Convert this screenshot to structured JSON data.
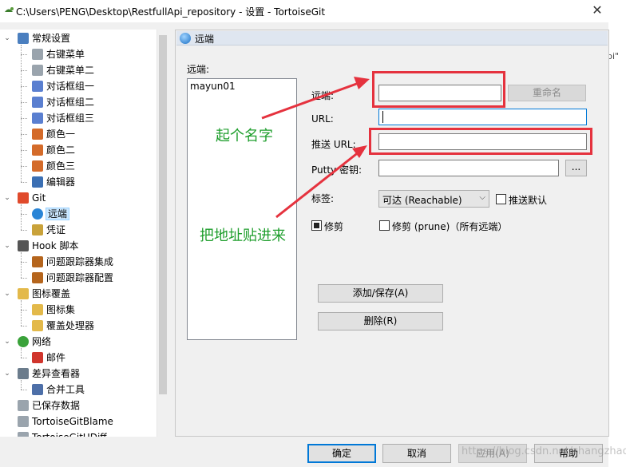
{
  "window": {
    "title": "C:\\Users\\PENG\\Desktop\\RestfullApi_repository - 设置 - TortoiseGit",
    "close_glyph": "✕",
    "background_text": "pi\""
  },
  "tree": {
    "items": [
      {
        "label": "常规设置",
        "icon": "wrench-icon",
        "expanded": true
      },
      {
        "label": "右键菜单",
        "icon": "gear-icon"
      },
      {
        "label": "右键菜单二",
        "icon": "gear-icon"
      },
      {
        "label": "对话框组一",
        "icon": "window-icon"
      },
      {
        "label": "对话框组二",
        "icon": "window-icon"
      },
      {
        "label": "对话框组三",
        "icon": "window-icon"
      },
      {
        "label": "颜色一",
        "icon": "palette-icon"
      },
      {
        "label": "颜色二",
        "icon": "palette-icon"
      },
      {
        "label": "颜色三",
        "icon": "palette-icon"
      },
      {
        "label": "编辑器",
        "icon": "editor-icon"
      },
      {
        "label": "Git",
        "icon": "git-icon",
        "expanded": true
      },
      {
        "label": "远端",
        "icon": "globe-icon",
        "selected": true
      },
      {
        "label": "凭证",
        "icon": "credential-icon"
      },
      {
        "label": "Hook 脚本",
        "icon": "hook-icon",
        "expanded": true
      },
      {
        "label": "问题跟踪器集成",
        "icon": "bug-icon"
      },
      {
        "label": "问题跟踪器配置",
        "icon": "bug-icon"
      },
      {
        "label": "图标覆盖",
        "icon": "folder-icon",
        "expanded": true
      },
      {
        "label": "图标集",
        "icon": "icon-set-icon"
      },
      {
        "label": "覆盖处理器",
        "icon": "folder-icon"
      },
      {
        "label": "网络",
        "icon": "network-icon",
        "expanded": true
      },
      {
        "label": "邮件",
        "icon": "at-icon"
      },
      {
        "label": "差异查看器",
        "icon": "magnifier-icon",
        "expanded": true
      },
      {
        "label": "合并工具",
        "icon": "merge-icon"
      },
      {
        "label": "已保存数据",
        "icon": "gear-icon"
      },
      {
        "label": "TortoiseGitBlame",
        "icon": "gear-icon"
      },
      {
        "label": "TortoiseGitUDiff",
        "icon": "gear-icon"
      }
    ]
  },
  "panel": {
    "header": "远端",
    "remotes_label": "远端:",
    "remotes": [
      "mayun01"
    ],
    "remote_field_label": "远端:",
    "remote_value": "",
    "rename_button": "重命名",
    "url_label": "URL:",
    "url_value": "",
    "push_url_label": "推送 URL:",
    "push_url_value": "",
    "putty_label": "Putty 密钥:",
    "putty_value": "",
    "browse_button": "...",
    "tag_label": "标签:",
    "tag_option": "可达 (Reachable)",
    "push_default_label": "推送默认",
    "push_default_checked": false,
    "prune_label": "修剪",
    "prune_checked": true,
    "prune_all_label": "修剪 (prune)（所有远端）",
    "prune_all_checked": false,
    "add_save_button": "添加/保存(A)",
    "delete_button": "删除(R)"
  },
  "annotations": {
    "name_hint": "起个名字",
    "paste_hint": "把地址贴进来",
    "color": "#e5323e",
    "text_color": "#1e9e2c"
  },
  "footer": {
    "ok": "确定",
    "cancel": "取消",
    "apply": "应用(A)",
    "help": "帮助",
    "watermark": "https://blog.csdn.net/zhangzhao236"
  }
}
